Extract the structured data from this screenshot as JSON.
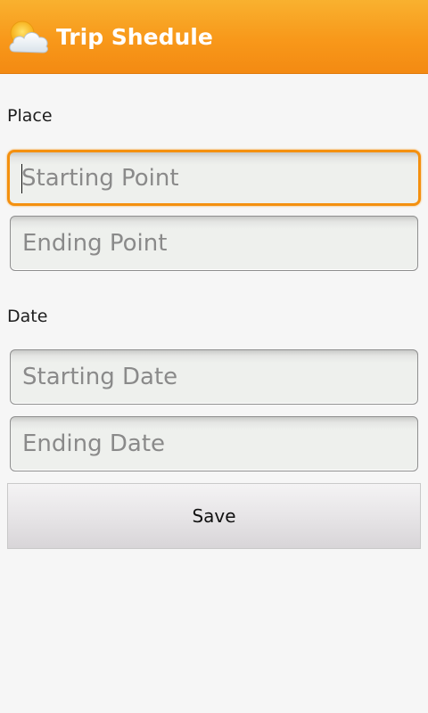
{
  "app_bar": {
    "icon": "partly-cloudy-icon",
    "title": "Trip Shedule",
    "accent_color": "#f8981a"
  },
  "place_section": {
    "label": "Place",
    "starting_point": {
      "value": "",
      "placeholder": "Starting Point",
      "focused": true
    },
    "ending_point": {
      "value": "",
      "placeholder": "Ending Point"
    }
  },
  "date_section": {
    "label": "Date",
    "starting_date": {
      "value": "",
      "placeholder": "Starting Date"
    },
    "ending_date": {
      "value": "",
      "placeholder": "Ending Date"
    }
  },
  "save_button": {
    "label": "Save"
  }
}
